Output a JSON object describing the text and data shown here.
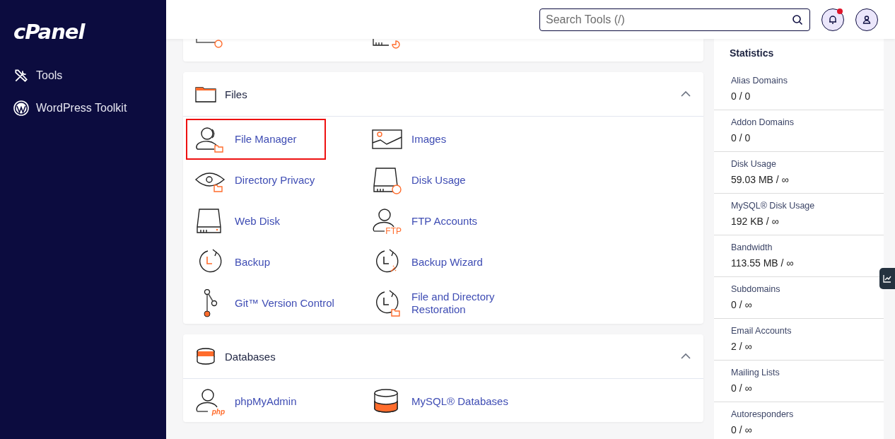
{
  "sidebar": {
    "logo": "cPanel",
    "items": [
      {
        "label": "Tools"
      },
      {
        "label": "WordPress Toolkit"
      }
    ]
  },
  "search": {
    "placeholder": "Search Tools (/)"
  },
  "notifications": {
    "unread": true
  },
  "sections": [
    {
      "title": "Files",
      "expanded": true,
      "items": [
        {
          "label": "File Manager",
          "highlighted": true
        },
        {
          "label": "Images",
          "highlighted": false
        },
        {
          "label": "Directory Privacy",
          "highlighted": false
        },
        {
          "label": "Disk Usage",
          "highlighted": false
        },
        {
          "label": "Web Disk",
          "highlighted": false
        },
        {
          "label": "FTP Accounts",
          "highlighted": false,
          "badge": "FTP"
        },
        {
          "label": "Backup",
          "highlighted": false
        },
        {
          "label": "Backup Wizard",
          "highlighted": false
        },
        {
          "label": "Git™ Version Control",
          "highlighted": false
        },
        {
          "label": "File and Directory Restoration",
          "highlighted": false
        }
      ]
    },
    {
      "title": "Databases",
      "expanded": true,
      "items": [
        {
          "label": "phpMyAdmin",
          "highlighted": false,
          "badge": "php"
        },
        {
          "label": "MySQL® Databases",
          "highlighted": false
        }
      ]
    }
  ],
  "statistics": {
    "title": "Statistics",
    "rows": [
      {
        "label": "Alias Domains",
        "value": "0 / 0"
      },
      {
        "label": "Addon Domains",
        "value": "0 / 0"
      },
      {
        "label": "Disk Usage",
        "value": "59.03 MB / ∞"
      },
      {
        "label": "MySQL® Disk Usage",
        "value": "192 KB / ∞"
      },
      {
        "label": "Bandwidth",
        "value": "113.55 MB / ∞"
      },
      {
        "label": "Subdomains",
        "value": "0 / ∞"
      },
      {
        "label": "Email Accounts",
        "value": "2 / ∞"
      },
      {
        "label": "Mailing Lists",
        "value": "0 / ∞"
      },
      {
        "label": "Autoresponders",
        "value": "0 / ∞"
      }
    ]
  }
}
